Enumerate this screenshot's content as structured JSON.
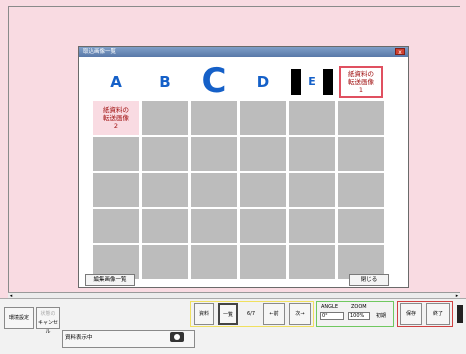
{
  "dialog": {
    "title": "取込画像一覧",
    "close_label": "x",
    "thumbnails": [
      {
        "type": "letter",
        "text": "A"
      },
      {
        "type": "letter",
        "text": "B"
      },
      {
        "type": "letter",
        "text": "C"
      },
      {
        "type": "letter",
        "text": "D"
      },
      {
        "type": "letter",
        "text": "E"
      },
      {
        "type": "paper",
        "text": "紙資料の\n転送画像\n1"
      },
      {
        "type": "paper",
        "text": "紙資料の\n転送画像\n2"
      }
    ],
    "edit_list_button": "編集画像一覧",
    "close_button": "閉じる"
  },
  "toolbar": {
    "btn_set": "環境設定",
    "btn_cancel": "キャンセル",
    "btn_cancel_top": "状態の",
    "status_text": "資料表示中",
    "btn_shiryo": "資料",
    "btn_ichiran": "一覧",
    "page_indicator": "6/7",
    "btn_prev": "←前",
    "btn_next": "次→",
    "angle_label": "ANGLE",
    "angle_value": "0°",
    "zoom_label": "ZOOM",
    "zoom_value": "100%",
    "btn_initial": "初期",
    "btn_save": "保存",
    "btn_end": "終了"
  },
  "colors": {
    "background": "#f9dbe2",
    "letter_blue": "#1560c8",
    "paper_red": "#a01010",
    "group_yellow": "#f0e060",
    "group_green": "#70c860",
    "group_red": "#d04040"
  }
}
